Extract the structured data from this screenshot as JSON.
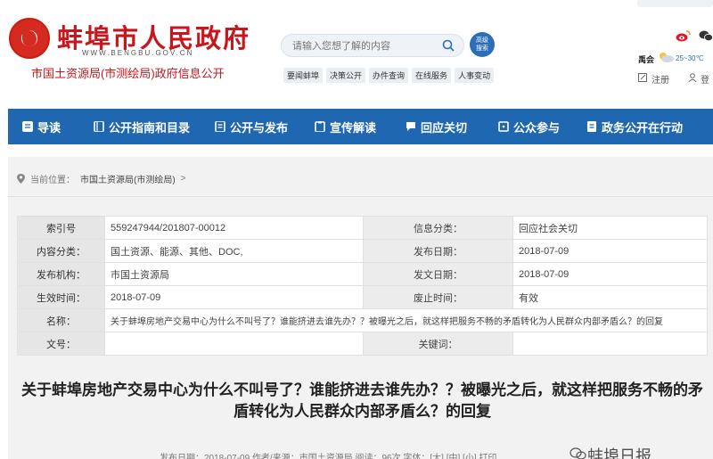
{
  "header": {
    "site_name": "蚌埠市人民政府",
    "site_domain": "WWW.BENGBU.GOV.CN",
    "sub_title": "市国土资源局(市测绘局)政府信息公开",
    "search": {
      "placeholder": "请输入您想了解的内容"
    },
    "adv_search_label": "高级\n搜索",
    "quick_links": [
      "要闻蚌埠",
      "决策公开",
      "办件查询",
      "在线服务",
      "人事变动"
    ],
    "weather": {
      "city": "禹会",
      "temp": "25~30℃"
    },
    "register_label": "注册",
    "login_label": "登"
  },
  "nav": [
    {
      "label": "导读",
      "icon": "list-icon"
    },
    {
      "label": "公开指南和目录",
      "icon": "book-icon"
    },
    {
      "label": "公开与发布",
      "icon": "document-icon"
    },
    {
      "label": "宣传解读",
      "icon": "clipboard-icon"
    },
    {
      "label": "回应关切",
      "icon": "chat-icon"
    },
    {
      "label": "公众参与",
      "icon": "comment-icon"
    },
    {
      "label": "政务公开在行动",
      "icon": "file-icon"
    }
  ],
  "breadcrumb": {
    "prefix": "当前位置：",
    "current": "市国土资源局(市测绘局)",
    "sep": ">"
  },
  "meta_table": {
    "index_no_label": "索引号",
    "index_no": "559247944/201807-00012",
    "info_class_label": "信息分类：",
    "info_class": "回应社会关切",
    "content_class_label": "内容分类：",
    "content_class": "国土资源、能源、其他、DOC,",
    "publish_date_label": "发布日期：",
    "publish_date": "2018-07-09",
    "publisher_label": "发布机构：",
    "publisher": "市国土资源局",
    "doc_date_label": "发文日期：",
    "doc_date": "2018-07-09",
    "effective_label": "生效时间：",
    "effective": "2018-07-09",
    "abolish_label": "废止时间：",
    "validity": "有效",
    "name_label": "名称：",
    "name": "关于蚌埠房地产交易中心为什么不叫号了？谁能挤进去谁先办？？被曝光之后，就这样把服务不畅的矛盾转化为人民群众内部矛盾么？的回复",
    "doc_no_label": "文号：",
    "doc_no": "",
    "keywords_label": "关键词：",
    "keywords": ""
  },
  "article": {
    "title": "关于蚌埠房地产交易中心为什么不叫号了？谁能挤进去谁先办？？被曝光之后，就这样把服务不畅的矛盾转化为人民群众内部矛盾么？的回复",
    "meta_line": "发布日期：2018-07-09   作者/来源：市国土资源局   阅读：96次   字体：[大] [中] [小]   打印",
    "watermark": "蚌埠日报"
  },
  "colors": {
    "nav_bg": "#1f67b1",
    "brand_red": "#c8161d",
    "panel_bg": "#f2f2f2"
  }
}
